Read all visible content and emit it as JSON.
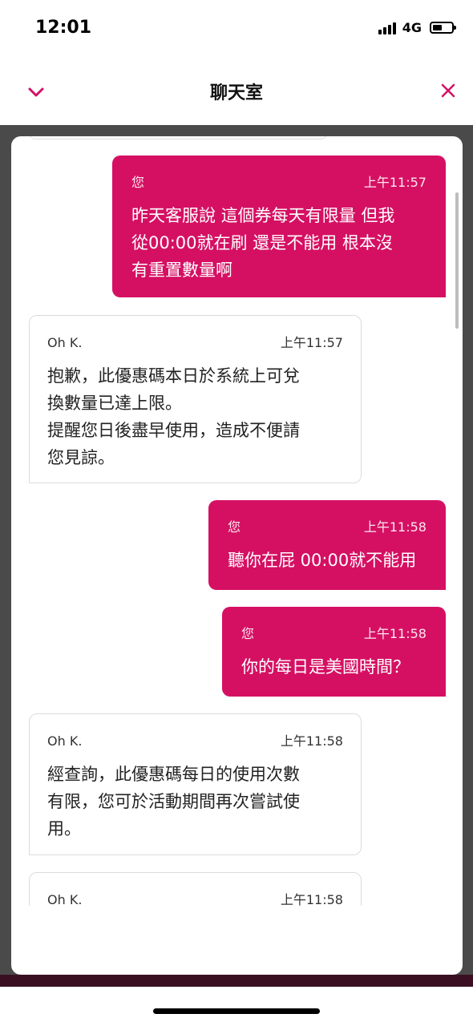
{
  "status_bar": {
    "time": "12:01",
    "network": "4G"
  },
  "header": {
    "title": "聊天室"
  },
  "messages": [
    {
      "sender": "您",
      "time": "上午11:57",
      "text": "昨天客服說 這個券每天有限量 但我\n從00:00就在刷 還是不能用 根本沒\n有重置數量啊"
    },
    {
      "sender": "Oh K.",
      "time": "上午11:57",
      "text": "抱歉，此優惠碼本日於系統上可兌\n換數量已達上限。\n提醒您日後盡早使用，造成不便請\n您見諒。"
    },
    {
      "sender": "您",
      "time": "上午11:58",
      "text": "聽你在屁 00:00就不能用"
    },
    {
      "sender": "您",
      "time": "上午11:58",
      "text": "你的每日是美國時間？"
    },
    {
      "sender": "Oh K.",
      "time": "上午11:58",
      "text": "經查詢，此優惠碼每日的使用次數\n有限，您可於活動期間再次嘗試使\n用。"
    },
    {
      "sender": "Oh K.",
      "time": "上午11:58",
      "text": ""
    }
  ],
  "colors": {
    "accent": "#d51063",
    "backdrop": "#4a4a4a"
  },
  "icons": {
    "collapse": "chevron-down-icon",
    "close": "close-icon"
  }
}
